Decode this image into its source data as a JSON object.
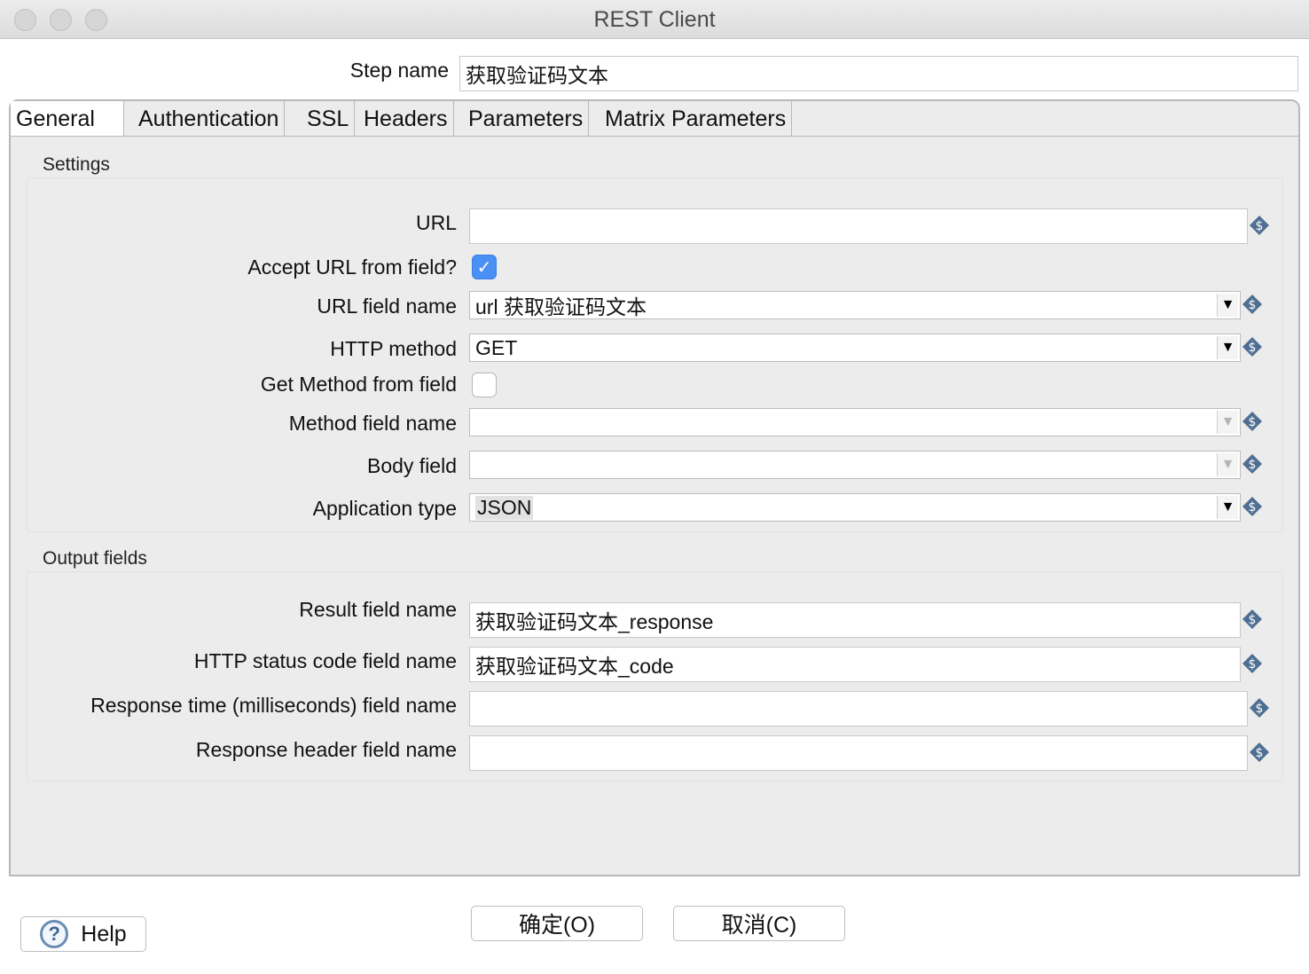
{
  "window": {
    "title": "REST Client"
  },
  "step": {
    "label": "Step name",
    "value": "获取验证码文本"
  },
  "tabs": [
    {
      "label": "General"
    },
    {
      "label": "Authentication"
    },
    {
      "label": "SSL"
    },
    {
      "label": "Headers"
    },
    {
      "label": "Parameters"
    },
    {
      "label": "Matrix Parameters"
    }
  ],
  "settings": {
    "title": "Settings",
    "url": {
      "label": "URL",
      "value": ""
    },
    "accept_url_from_field": {
      "label": "Accept URL from field?",
      "checked": true
    },
    "url_field_name": {
      "label": "URL field name",
      "value": "url  获取验证码文本"
    },
    "http_method": {
      "label": "HTTP method",
      "value": "GET"
    },
    "get_method_from_field": {
      "label": "Get Method from field",
      "checked": false
    },
    "method_field_name": {
      "label": "Method field name",
      "value": ""
    },
    "body_field": {
      "label": "Body field",
      "value": ""
    },
    "application_type": {
      "label": "Application type",
      "value": "JSON"
    }
  },
  "output": {
    "title": "Output fields",
    "result_field_name": {
      "label": "Result field name",
      "value": "获取验证码文本_response"
    },
    "http_status_code_field_name": {
      "label": "HTTP status code field name",
      "value": "获取验证码文本_code"
    },
    "response_time_field_name": {
      "label": "Response time (milliseconds) field name",
      "value": ""
    },
    "response_header_field_name": {
      "label": "Response header field name",
      "value": ""
    }
  },
  "buttons": {
    "help": "Help",
    "ok": "确定(O)",
    "cancel": "取消(C)"
  },
  "icons": {
    "variable": "variable-dollar-icon",
    "help": "help-question-icon",
    "check": "✓",
    "arrow": "▼",
    "variable_color": "#4f6f92"
  }
}
